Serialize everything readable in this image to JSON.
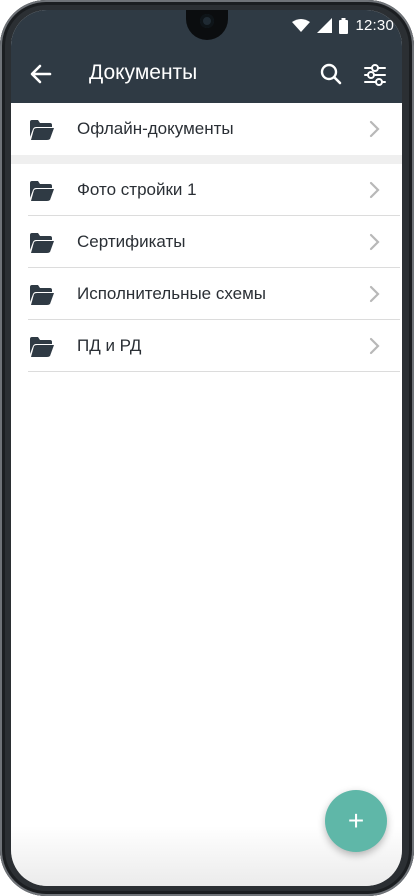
{
  "status_bar": {
    "time": "12:30",
    "icons": [
      "wifi-icon",
      "signal-icon",
      "battery-icon"
    ]
  },
  "app_bar": {
    "title": "Документы",
    "back_icon": "back-arrow-icon",
    "search_icon": "search-icon",
    "filter_icon": "filter-settings-icon"
  },
  "offline": {
    "label": "Офлайн-документы",
    "icon": "folder-open-icon"
  },
  "folders": [
    {
      "label": "Фото стройки 1",
      "icon": "folder-open-icon"
    },
    {
      "label": "Сертификаты",
      "icon": "folder-open-icon"
    },
    {
      "label": "Исполнительные схемы",
      "icon": "folder-open-icon"
    },
    {
      "label": "ПД и РД",
      "icon": "folder-open-icon"
    }
  ],
  "fab": {
    "label": "+",
    "icon": "plus-icon"
  },
  "colors": {
    "appbar": "#2f3a44",
    "fab": "#5fb7a8",
    "text": "#2a2f35",
    "chevron": "#b8b8b8"
  }
}
